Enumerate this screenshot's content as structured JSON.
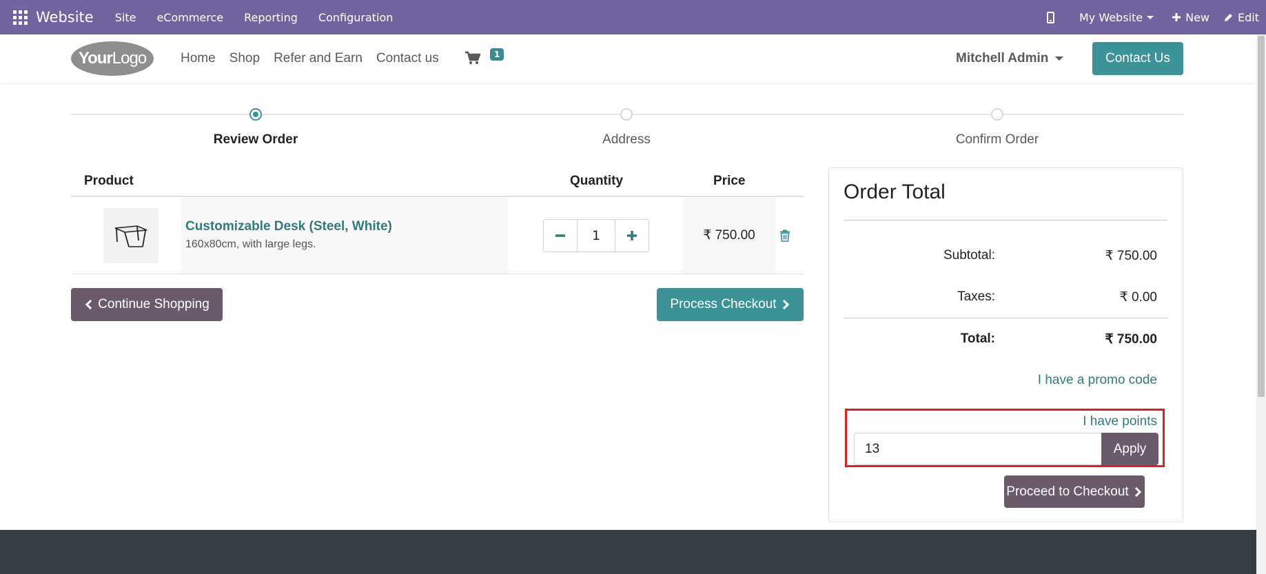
{
  "adminbar": {
    "brand": "Website",
    "menu": [
      "Site",
      "eCommerce",
      "Reporting",
      "Configuration"
    ],
    "website_selector": "My Website",
    "new_label": "New",
    "edit_label": "Edit"
  },
  "header": {
    "logo_bold": "Your",
    "logo_rest": "Logo",
    "nav": [
      "Home",
      "Shop",
      "Refer and Earn",
      "Contact us"
    ],
    "cart_count": "1",
    "user": "Mitchell Admin",
    "contact_button": "Contact Us"
  },
  "wizard": {
    "steps": [
      "Review Order",
      "Address",
      "Confirm Order"
    ],
    "active_step": "Review Order"
  },
  "cart": {
    "headers": {
      "product": "Product",
      "quantity": "Quantity",
      "price": "Price"
    },
    "item": {
      "name": "Customizable Desk (Steel, White)",
      "description": "160x80cm, with large legs.",
      "quantity": "1",
      "price": "₹ 750.00"
    },
    "continue_label": "Continue Shopping",
    "process_label": "Process Checkout"
  },
  "order_total": {
    "title": "Order Total",
    "subtotal_label": "Subtotal:",
    "subtotal_value": "₹ 750.00",
    "taxes_label": "Taxes:",
    "taxes_value": "₹ 0.00",
    "total_label": "Total:",
    "total_value": "₹ 750.00",
    "promo_link": "I have a promo code",
    "points_link": "I have points",
    "points_value": "13",
    "apply_label": "Apply",
    "proceed_label": "Proceed to Checkout"
  },
  "colors": {
    "adminbar": "#71639e",
    "primary": "#3c9397",
    "secondary": "#6b5a6b",
    "highlight": "#e02020",
    "footer": "#373d45"
  }
}
